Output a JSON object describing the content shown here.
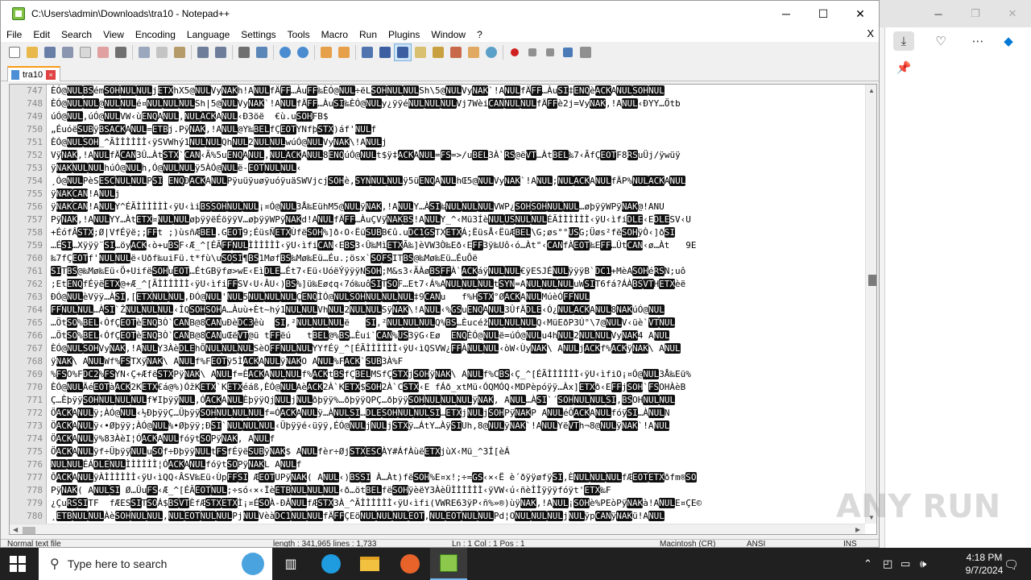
{
  "window": {
    "title": "C:\\Users\\admin\\Downloads\\tra10 - Notepad++",
    "minimize": "─",
    "maximize": "☐",
    "close": "✕"
  },
  "menu": {
    "items": [
      "File",
      "Edit",
      "Search",
      "View",
      "Encoding",
      "Language",
      "Settings",
      "Tools",
      "Macro",
      "Run",
      "Plugins",
      "Window",
      "?"
    ],
    "close": "X"
  },
  "tab": {
    "name": "tra10",
    "close": "×"
  },
  "editor": {
    "lines": [
      {
        "n": "747",
        "t": "ÈÓ@NULBSémSOHNULNULjETXhX5@NULVyNAKh!ANULfÄFF…ÀuFF‰ÈÓ@NUL÷ëLSOHNULNULSh\\5@NULVyNAK`!ANULfÄFF…ÀuSI‡ENQèACKANULSOHNUL"
      },
      {
        "n": "748",
        "t": "ÈÓ@NULNUL@NULNULé¤NULNULNULSh|5@NULVyNAK`!ANULfÄFF…ÀuSI‰ÈÓ@NULy¿ÿÿéNULNULNULVj7WèiCANNULNULfÄFFè2j=VyNAK,!ANUL‹ÐYY…Ötb"
      },
      {
        "n": "749",
        "t": "úÓ@NUL,úÓ@NULVW‹ùENQANUL,NULACKANUL‹Ð3öë  €ù.uSOHFB$"
      },
      {
        "n": "750",
        "t": "„ÉuóëSUBÿBSACKANUL=ETBj.PÿNAK,!ANUL@Y‰BELfÇEOTYNfþSTX)áf'NULf"
      },
      {
        "n": "751",
        "t": "ÈÓ@NULSOH_^ÃÌÌÌÌÌÌ‹ÿSVWhý1NULNULQhNUL2NULNULwúÓ@NULVyNAK\\!ANULj"
      },
      {
        "n": "752",
        "t": "VÿNAK,!ANULfÄCAN3Û…ÀtSTX`CAN‹Ã%5uENQANUL,NULACKANUL8ENQúÓ@NULt$ÿ‡ACKANUL=FS=>/uBEL3À`RS@ëVT…ÀtBEL‰7‹ÃfÇEOTF8RSuÜj/ÿwüÿ"
      },
      {
        "n": "753",
        "t": "ÿNAKNULNULhúÓ@NULh,Ó@NULNULÿ5ÀÓ@NULë-EOTNULNUL‹"
      },
      {
        "n": "754",
        "t": "¸Ó@NULPèSESCNULNULPSI ENQÐACKANULPÿuüÿuøÿuóÿuäSWVjcjSOHè,SYNNULNULÿ5üENQANULhŒ5@NULVyNAK`!ANUL;NULACKANULfÄP%NULACKANUL"
      },
      {
        "n": "755",
        "t": "ÿNAKCAN!ANULj"
      },
      {
        "n": "756",
        "t": "ÿNAKCAN!ANULY^ÉÃÌÌÌÌÌÌ‹ÿU‹ìiBSSOHNULNUL¡¤Ó@NUL3Å‰EühM5@NULÿNAK,!ANULY…ÀSI‰NULNULNULVWP¿SOHSOHNULNUL…øþÿÿWPÿNAK@!ANU"
      },
      {
        "n": "757",
        "t": "PÿNAK,!ANULYY…ÀtETX¤NULNULøþÿÿëÉöÿÿV…øþÿÿWPÿNAKd!ANULfÄFF…ÀuÇVÿNAKBS!ANULY_^‹Mü3ÍèNULUSNULNULÉÃÌÌÌÌÌÌ‹ÿU‹ìfiDLE‹EDLESV‹U"
      },
      {
        "n": "758",
        "t": "+ÉófÂSTX;Ø|VfÉÿë;;FFt ;)ùsñÆBEL.GEOT9;ÉüsÑETXÙfëSOH%]ð‹O‹ËüSUBB€û.uDC1GSTXETXÁ;ËüsÅ‹ËüÆBEL\\G;øs°°USG;Üøs²fëSOHÿÒ‹]ðSI"
      },
      {
        "n": "759",
        "t": "…ÉSI…Xÿÿÿ¨SI…öyACK‹ò+uBSF‹Æ_^[ÉÃFFNULÌÌÌÌÌÌ‹ÿU‹ìfiCAN‹EBS3‹Û‰MìETXÃ‰]èVW3Ò‰Eð‹EFF3ÿ‰Uô‹ó…Àt\"‹CANfÀEOT‰EFF…ÛtCAN‹ø…Àt   9E"
      },
      {
        "n": "760",
        "t": "‰7fÇEOTf'NULNULë‹Uðf‰uiFü.t*fù\\uSOSI¶BS1MøfBS‰Mø‰Eü…Éu.;ösx`SOFSITBS@‰Mø‰Eü…ÉuÔë"
      },
      {
        "n": "761",
        "t": "SITBS@‰Mø‰Eü‹Ö+UifëSOHuEOT…ÉtGBÿfø>wE‹EìDLE…Ét7‹Eü‹UóëÝÿÿÿNSOH;M&s3‹ÃÀøBSFFÀ`ACKáÿNULNUL€ÿESJÉNULÿÿÿB`DC1+MèASOHéRSN;uô"
      },
      {
        "n": "762",
        "t": ";EtENQfÉÿëETX@+Æ_^[ÃÌÌÌÌÌÌ‹ÿU‹ìfiFFSV‹U‹ÂU‹)BS%]ü‰Eø¢q‹7ó‰uôSITSOF…Et7‹Á%ANULNULNULtSYN=ANULNULNULuWSIT6fá?ÁÀBSVTHETXèë"
      },
      {
        "n": "763",
        "t": "ÐÓ@NULèVÿÿ…ÀSI,[ETXNULNUL,ÐÓ@NUL'NUL5NULNULNULÇENQÌÓ@NULSOHNULNULNUL‡9CANu   f%HSTX°ØACKANULMúèÓFFNUL"
      },
      {
        "n": "764",
        "t": "FFNULNUL…ÀSI`ŽNULNULNUL‹ÎQSOHSOHA…Àuù+Èt~hý1NULNULVhNUL2NULNULSÿNAK\\!ANUL‹%GSuENQANUL3ÛfÄDLE‹Ó¿NULACKANUL8NAKúÓ@NUL"
      },
      {
        "n": "765",
        "t": "…ÖtSO%BEL‹ÓfÇEOTèENQ3Ò`CANB@8CANuÐèDC3êù  SI,²NULNULNULë   SI,²NULNULNULQ%BS…ÈucéžNULNULNULQ‹MüEðP3Ú°\\7@NULV‹üè`VTNUL"
      },
      {
        "n": "766",
        "t": "…ÖtSO%BEL‹ÓfÇEOTèENQ3Ò`CANB@8CANuŒëVT@ü tFFëú   tBEL@%BS…Èui`CAN%US3ÿG‹Eø  ENQÈÓ@NULë=úÓ@NULu4hNUL2NULNULVyNAK4 ANUL"
      },
      {
        "n": "767",
        "t": "ÈÓ@NULSOHVyNAK,!ANULY3ÀèDLEhÕNULNULNULSèOFFNULNULYYfÉÿ_^[ÉÃÌÌÌÌÌÌ‹ÿU‹ìQSVW¿FFÀNULNUL‹òW‹ÙyNAK\\ ANULjACKf%ACKÿNAK\\ ANUL"
      },
      {
        "n": "768",
        "t": "ÿNAK\\ ANULWf%FSTXÿNAK\\ ANULf%FEOTÿ5ÌACKANULÿNAKO ANUL%FACK`SUB3À%F"
      },
      {
        "n": "769",
        "t": "%FSO%FDC2%FSYN‹Ç+ÆfëSTXPÿNAK\\ ANULf=ÈACKANULNULf%ACKtBSfÇBELMSfÇSTXjSOHÿNAK\\ ANULf%CBS‹Ç_^[ÉÃÌÌÌÌÌÌ‹ÿU‹ìfiO¡¤Ó@NUL3Å‰Eü%"
      },
      {
        "n": "770",
        "t": "ÈÓ@NULÄéEOTàACK2KETX€á@%)ÓžKETX`KETXéáß,ÈÓ@NULAèACK2À`KETX$SOH2À`CSTX‹E fÁð_xtMü‹ÓQMÓQ‹MDPèpóÿÿ…Àx]ETXð‹EFFjSOH`FSOHÀèB"
      },
      {
        "n": "771",
        "t": "Ç…ÈþÿÿSOHNULNULNULf¥IþÿÿNUL,ÓACKANULÈþÿÿQjNULjNULðþÿÿ%…ðþÿÿQPÇ…ðþÿÿSOHNULNULNULÿNAK, ANUL…ÀSI`´SOHNULNULSI,BSOHNULNUL"
      },
      {
        "n": "772",
        "t": "ÖACKANULÿ;ÀÓ@NUL‹½ÐþÿÿÇ…ÜþÿÿSOHNULNULNULf=ÓACKANULÿ…ÀNULSI…DLESOHNULNULSI…ETXjNULjSOHPÿNAKP ANULéÕACKANULfóÿSI…ÀNULN"
      },
      {
        "n": "773",
        "t": "ÖACKANULÿ‹•Øþÿÿ;ÀÓ@NUL%•Øþÿÿ;ÐSI`NULNULNUL‹Üþÿÿé‹üÿÿ,ÉÓ@NULjNULjSTXÿ…ÁtY…ÀÿSIUh,8@NULÿNAK`!ANULYëVTh¬8@NULÿNAK`!ANUL"
      },
      {
        "n": "774",
        "t": "ÖACKANULÿ%83ÀèI¦ÓACKANULfóÿtSOPÿNAK, ANULf"
      },
      {
        "n": "775",
        "t": "ÖACKANULÿf÷ÜþÿÿNULuSOf÷ÐþÿÿNULtFSfÉÿëSUBÿNAK$ ANULfèr÷ØjSTXESCÀY#ÁfÀùëETXjùX‹Mü_^3Í[èÁ"
      },
      {
        "n": "776",
        "t": "NULNULÉÁDLENULÌÌÌÌÌÌ¦ÓACKANULfóÿtSOPÿNAKL ANULf"
      },
      {
        "n": "777",
        "t": "ÔACKANULÿÀÌÌÌÌÌÌ‹ÿU‹ìQQ‹ÂSV‰Eü‹ÙpFFSI ÆEOTUPÿNAK( ANUL‹)BSSI À…Àt)fëSOH%E¤x!;÷=GS‹×‹Ë è´ðÿÿøfÿSI,ÈNULNULNULfÆEOTETXðfm®SO"
      },
      {
        "n": "778",
        "t": "PÿNAK( ANULSI Ø…ÛuFS‹Æ_^[ÉÃEOTNUL;÷só‹×‹ÏèETBNULNULNUL‹ð…ötBELfëSOHÿèëY3ÀèÜÌÌÌÌÌÌ‹ÿVW‹ú‹ñèÌÌÿÿÿfóÿt'ETX‰F"
      },
      {
        "n": "779",
        "t": "¿ÇuRSSITF  fÆESSITSOÁ$BSVTÈfÆSTXETXÌ¡¤ÉSOÀ-ÐÂNULfÆSTX3À_^ÃÌÌÌÌÌÌ‹ÿU‹ìfi(VWRE63ÿP‹ñ%»®)ùÿNAK‚!ANUL¡SOHè%PEòPÿNAKà!ANULE¤ÇE©"
      },
      {
        "n": "780",
        "t": "¸ETBNULNULÀèSOHNULNUL,NULEOTNULNULPjNULVèàDC1NULNULfÄFFÇEöNULNULNULEOT,NULEOTNULNULPd¦ONULNULNULjNULÿpCANÿNAKü!ANUL"
      }
    ]
  },
  "statusbar": {
    "type": "Normal text file",
    "length": "length : 341,965    lines : 1,733",
    "position": "Ln : 1    Col : 1    Pos : 1",
    "eol": "Macintosh (CR)",
    "encoding": "ANSI",
    "mode": "INS"
  },
  "watermark": "ANY RUN",
  "taskbar": {
    "search_placeholder": "Type here to search",
    "time": "4:18 PM",
    "date": "9/7/2024"
  },
  "colors": {
    "control_char_bg": "#101010",
    "control_char_fg": "#ffffff",
    "tab_accent": "#fa9a14",
    "taskbar": "#202020",
    "edge_accent": "#0078d4"
  }
}
